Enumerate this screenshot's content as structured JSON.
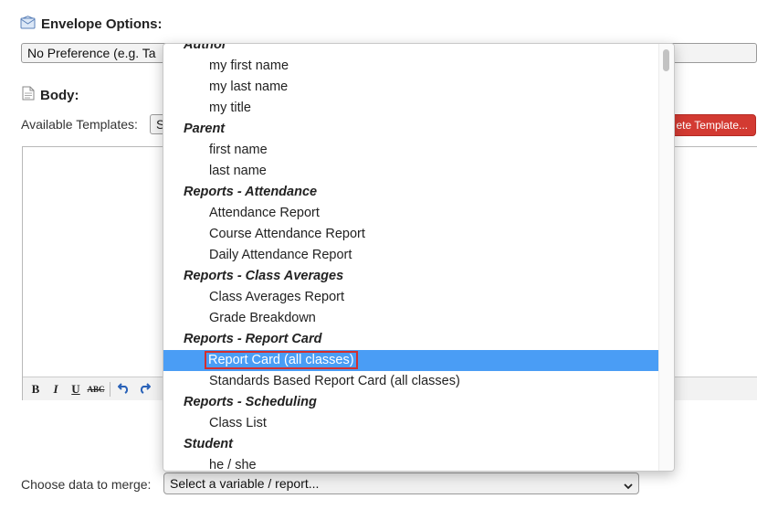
{
  "envelope": {
    "title": "Envelope Options:",
    "select_value": "No Preference (e.g. Ta"
  },
  "body_section": {
    "title": "Body:",
    "templates_label": "Available Templates:",
    "templates_value": "S",
    "delete_button": "ete Template..."
  },
  "toolbar": {
    "bold": "B",
    "italic": "I",
    "underline": "U",
    "strike": "ABC"
  },
  "merge": {
    "label": "Choose data to merge:",
    "select_value": "Select a variable / report..."
  },
  "dropdown": {
    "rows": [
      {
        "type": "group",
        "label": "Author"
      },
      {
        "type": "opt",
        "label": "my first name"
      },
      {
        "type": "opt",
        "label": "my last name"
      },
      {
        "type": "opt",
        "label": "my title"
      },
      {
        "type": "group",
        "label": "Parent"
      },
      {
        "type": "opt",
        "label": "first name"
      },
      {
        "type": "opt",
        "label": "last name"
      },
      {
        "type": "group",
        "label": "Reports - Attendance"
      },
      {
        "type": "opt",
        "label": "Attendance Report"
      },
      {
        "type": "opt",
        "label": "Course Attendance Report"
      },
      {
        "type": "opt",
        "label": "Daily Attendance Report"
      },
      {
        "type": "group",
        "label": "Reports - Class Averages"
      },
      {
        "type": "opt",
        "label": "Class Averages Report"
      },
      {
        "type": "opt",
        "label": "Grade Breakdown"
      },
      {
        "type": "group",
        "label": "Reports - Report Card"
      },
      {
        "type": "opt",
        "label": "Report Card (all classes)",
        "selected": true
      },
      {
        "type": "opt",
        "label": "Standards Based Report Card (all classes)"
      },
      {
        "type": "group",
        "label": "Reports - Scheduling"
      },
      {
        "type": "opt",
        "label": "Class List"
      },
      {
        "type": "group",
        "label": "Student"
      },
      {
        "type": "opt",
        "label": "he / she"
      }
    ]
  },
  "colors": {
    "selection": "#4a9df5",
    "selection_outline": "#d32f2f",
    "delete_button": "#d33a32"
  }
}
